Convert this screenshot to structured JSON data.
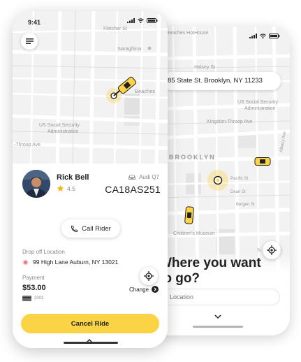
{
  "front": {
    "status_time": "9:41",
    "map_labels": {
      "fletcher": "Fletcher St",
      "sara": "Saraghina",
      "beaches": "Beaches",
      "ssa1": "US Social Security",
      "ssa2": "Administration",
      "throop": "-Throop Ave"
    },
    "driver": {
      "name": "Rick Bell",
      "rating": "4.5"
    },
    "car": {
      "model": "Audi Q7",
      "plate": "CA18AS251"
    },
    "call_label": "Call Rider",
    "dropoff": {
      "label": "Drop off Location",
      "address": "99 High Lane Auburn, NY 13021"
    },
    "payment": {
      "label": "Payment",
      "amount": "$53.00",
      "card": "2003"
    },
    "change_label": "Change",
    "cancel_label": "Cancel Ride",
    "colors": {
      "accent": "#fbd445",
      "map": "#f2f2f2",
      "pin": "#f26b6b"
    }
  },
  "back": {
    "map_labels": {
      "hothouse": "Beaches HotHouse",
      "halsey": "Halsey St",
      "ssa1": "US Social Security",
      "ssa2": "Administration",
      "kingston": "Kingston-Throop Ave",
      "brooklyn": "BROOKLYN",
      "pacific": "Pacific St",
      "albany": "Albany Ave",
      "dean": "Dean St",
      "bergen": "Bergen St",
      "museum": "Children's Museum",
      "st_marks": "St Marks Ave"
    },
    "address": "85 State St. Brooklyn, NY 11233",
    "question": "Where you want to go?",
    "location_placeholder": "Location"
  }
}
